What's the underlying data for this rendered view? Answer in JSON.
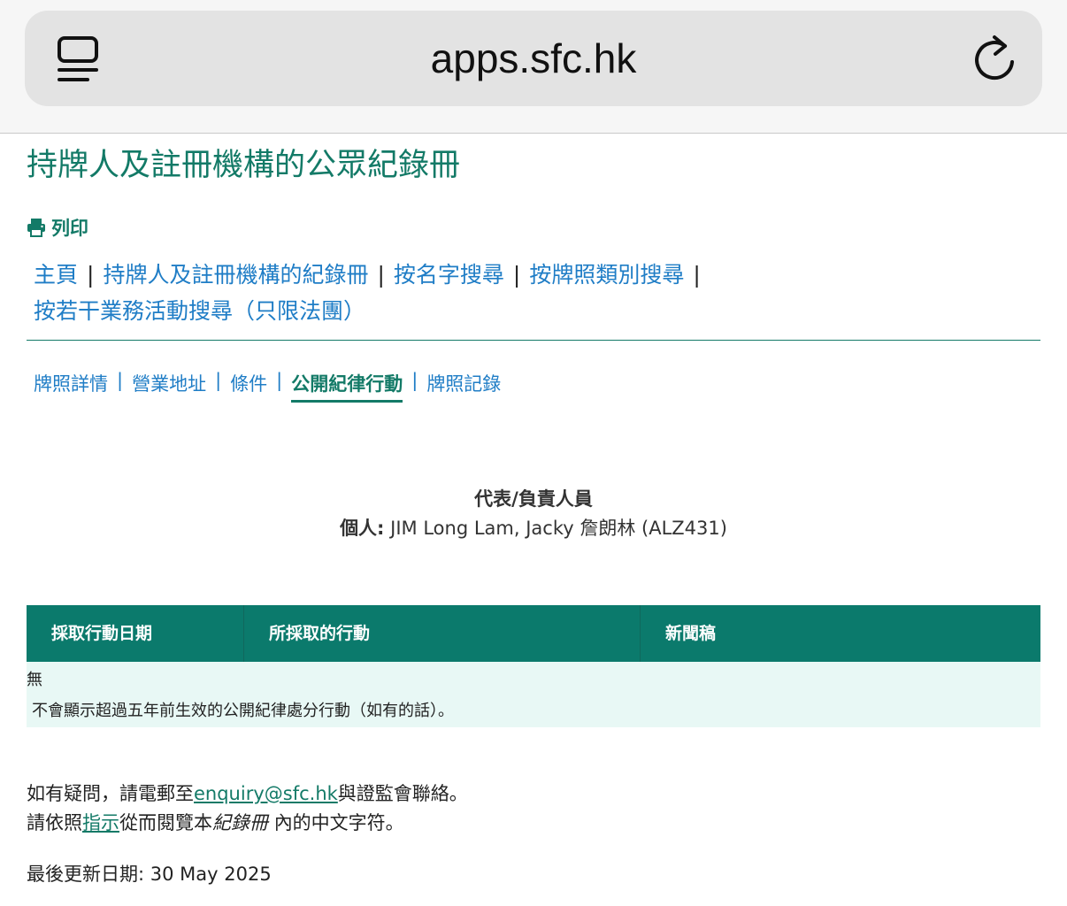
{
  "browser": {
    "url": "apps.sfc.hk"
  },
  "page": {
    "title": "持牌人及註冊機構的公眾紀錄冊",
    "print_label": "列印"
  },
  "nav": {
    "items": [
      "主頁",
      "持牌人及註冊機構的紀錄冊",
      "按名字搜尋",
      "按牌照類別搜尋",
      "按若干業務活動搜尋（只限法團）"
    ],
    "separator": "|"
  },
  "tabs": {
    "items": [
      "牌照詳情",
      "營業地址",
      "條件",
      "公開紀律行動",
      "牌照記錄"
    ],
    "active_index": 3
  },
  "representative": {
    "heading": "代表/負責人員",
    "person_label": "個人:",
    "person_value": "JIM Long Lam, Jacky 詹朗林 (ALZ431)"
  },
  "table": {
    "headers": [
      "採取行動日期",
      "所採取的行動",
      "新聞稿"
    ],
    "empty_text": "無",
    "note": "不會顯示超過五年前生效的公開紀律處分行動（如有的話）。"
  },
  "footer": {
    "line1_prefix": "如有疑問，請電郵至",
    "email": "enquiry@sfc.hk",
    "line1_suffix": "與證監會聯絡。",
    "line2_prefix": "請依照",
    "guide_link": "指示",
    "line2_middle": "從而閱覽本",
    "line2_italic": "紀錄冊",
    "line2_suffix": "內的中文字符。",
    "last_updated": "最後更新日期: 30 May 2025"
  },
  "colors": {
    "brand_green": "#137a67",
    "header_teal": "#0b7a6c",
    "link_blue": "#1f7dc6",
    "row_bg": "#e8f8f5"
  }
}
